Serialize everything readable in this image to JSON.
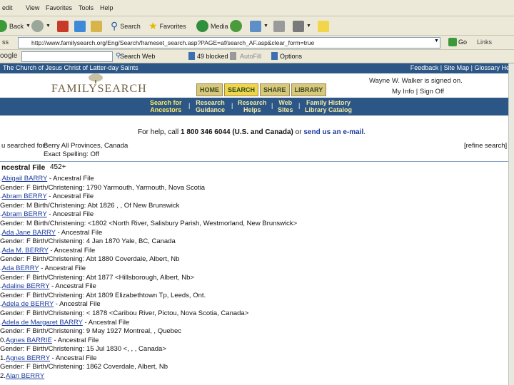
{
  "browser": {
    "menu": [
      "edit",
      "View",
      "Favorites",
      "Tools",
      "Help"
    ],
    "toolbar": {
      "back": "Back",
      "search": "Search",
      "favorites": "Favorites",
      "media": "Media"
    },
    "address": "http://www.familysearch.org/Eng/Search/frameset_search.asp?PAGE=af/search_AF.asp&clear_form=true",
    "go": "Go",
    "links": "Links",
    "google": {
      "label": "oogle",
      "search_web": "Search Web",
      "blocked": "49 blocked",
      "autofill": "AutoFill",
      "options": "Options"
    }
  },
  "site": {
    "church": "The Church of Jesus Christ of Latter-day Saints",
    "util": "Feedback | Site Map | Glossary  Hel",
    "logo": "FAMILYSEARCH",
    "tabs": [
      {
        "label": "HOME"
      },
      {
        "label": "SEARCH"
      },
      {
        "label": "SHARE"
      },
      {
        "label": "LIBRARY"
      }
    ],
    "signed_in": "Wayne W. Walker is signed on.",
    "myinfo": "My Info | Sign Off",
    "subnav": [
      "Search for\nAncestors",
      "Research\nGuidance",
      "Research\nHelps",
      "Web\nSites",
      "Family History\nLibrary Catalog"
    ],
    "help_prefix": "For help, call ",
    "help_phone": "1 800 346 6044 (U.S. and Canada)",
    "help_mid": " or ",
    "help_link": "send us an e-mail",
    "help_suffix": "."
  },
  "search": {
    "label": "u searched for:",
    "criteria1": "Berry  All Provinces, Canada",
    "criteria2": "Exact Spelling: Off",
    "refine": "[refine search]",
    "result_title": "ncestral File",
    "result_count": "452+"
  },
  "results": [
    {
      "num": ". ",
      "name": "Abigail BARRY",
      "source": " - Ancestral File",
      "detail": "Gender: F Birth/Christening: 1790 Yarmouth, Yarmouth, Nova Scotia"
    },
    {
      "num": ". ",
      "name": "Abram BERRY",
      "source": " - Ancestral File",
      "detail": "Gender: M Birth/Christening: Abt 1826 , , Of New Brunswick"
    },
    {
      "num": ". ",
      "name": "Abram BERRY",
      "source": " - Ancestral File",
      "detail": "Gender: M Birth/Christening: <1802 <North River, Salisbury Parish, Westmorland, New Brunswick>"
    },
    {
      "num": ". ",
      "name": "Ada Jane BARRY",
      "source": " - Ancestral File",
      "detail": "Gender: F Birth/Christening: 4 Jan 1870 Yale, BC, Canada"
    },
    {
      "num": ". ",
      "name": "Ada M. BERRY",
      "source": " - Ancestral File",
      "detail": "Gender: F Birth/Christening: Abt 1880 Coverdale, Albert, Nb"
    },
    {
      "num": ". ",
      "name": "Ada BERRY",
      "source": " - Ancestral File",
      "detail": "Gender: F Birth/Christening: Abt 1877 <Hillsborough, Albert, Nb>"
    },
    {
      "num": ". ",
      "name": "Adaline BERRY",
      "source": " - Ancestral File",
      "detail": "Gender: F Birth/Christening: Abt 1809 Elizabethtown Tp, Leeds, Ont."
    },
    {
      "num": ". ",
      "name": "Adela de BERRY",
      "source": " - Ancestral File",
      "detail": "Gender: F Birth/Christening: < 1878 <Caribou River, Pictou, Nova Scotia, Canada>"
    },
    {
      "num": ". ",
      "name": "Adela de Margaret BARRY",
      "source": " - Ancestral File",
      "detail": "Gender: F Birth/Christening: 9 May 1927 Montreal, , Quebec"
    },
    {
      "num": "0. ",
      "name": "Agnes BARRIE",
      "source": " - Ancestral File",
      "detail": "Gender: F Birth/Christening: 15 Jul 1830 <, , , Canada>"
    },
    {
      "num": "1. ",
      "name": "Agnes BERRY",
      "source": " - Ancestral File",
      "detail": "Gender: F Birth/Christening: 1862 Coverdale, Albert, Nb"
    },
    {
      "num": "2. ",
      "name": "Alan BERRY",
      "source": "",
      "detail": ""
    }
  ]
}
